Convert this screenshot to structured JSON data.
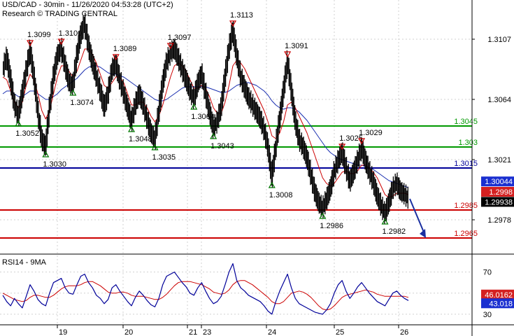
{
  "header": {
    "line1": "USD/CAD - 30min - 11/26/2020 04:53:28 (UTC+2)",
    "line2": "Research © TRADING CENTRAL"
  },
  "chart_data": {
    "type": "line",
    "instrument": "USD/CAD",
    "timeframe": "30min",
    "x_tick_labels": [
      "19",
      "20",
      "21",
      "23",
      "24",
      "25",
      "26"
    ],
    "price_panel": {
      "ylim": [
        1.2955,
        1.3135
      ],
      "y_tick_labels": [
        "1.3107",
        "1.3064",
        "1.3021",
        "1.2978"
      ],
      "y_tick_values": [
        1.3107,
        1.3064,
        1.3021,
        1.2978
      ],
      "price_path": [
        1.3085,
        1.3094,
        1.3078,
        1.306,
        1.3052,
        1.3068,
        1.3084,
        1.3099,
        1.308,
        1.3055,
        1.3035,
        1.303,
        1.3058,
        1.308,
        1.3095,
        1.31,
        1.3088,
        1.3076,
        1.3074,
        1.3095,
        1.311,
        1.3118,
        1.3102,
        1.309,
        1.308,
        1.307,
        1.3058,
        1.3068,
        1.3085,
        1.3089,
        1.3078,
        1.3068,
        1.3058,
        1.3048,
        1.306,
        1.3068,
        1.306,
        1.305,
        1.304,
        1.3035,
        1.3055,
        1.3075,
        1.309,
        1.3097,
        1.31,
        1.3093,
        1.3085,
        1.3078,
        1.307,
        1.3064,
        1.3075,
        1.3082,
        1.3068,
        1.3055,
        1.3043,
        1.3048,
        1.3058,
        1.308,
        1.31,
        1.3113,
        1.3095,
        1.308,
        1.3072,
        1.3065,
        1.306,
        1.3055,
        1.305,
        1.3042,
        1.303,
        1.3008,
        1.303,
        1.305,
        1.307,
        1.3091,
        1.307,
        1.3048,
        1.3035,
        1.303,
        1.3022,
        1.301,
        1.2998,
        1.299,
        1.2986,
        1.2992,
        1.3,
        1.3012,
        1.302,
        1.3026,
        1.3015,
        1.3005,
        1.3012,
        1.302,
        1.3029,
        1.302,
        1.3012,
        1.3005,
        1.2995,
        1.2988,
        1.2982,
        1.299,
        1.3,
        1.3004,
        1.2998,
        1.2996,
        1.2993
      ],
      "ma_fast": [
        1.308,
        1.3078,
        1.307,
        1.3062,
        1.3058,
        1.3062,
        1.3074,
        1.3082,
        1.3078,
        1.3068,
        1.3056,
        1.305,
        1.3056,
        1.3068,
        1.308,
        1.3088,
        1.3088,
        1.3084,
        1.308,
        1.3084,
        1.3092,
        1.31,
        1.31,
        1.3096,
        1.309,
        1.3082,
        1.3074,
        1.3072,
        1.3076,
        1.308,
        1.308,
        1.3076,
        1.3068,
        1.306,
        1.306,
        1.3062,
        1.3062,
        1.3058,
        1.3052,
        1.3048,
        1.3052,
        1.306,
        1.307,
        1.308,
        1.3088,
        1.309,
        1.3088,
        1.3084,
        1.3078,
        1.3072,
        1.3072,
        1.3074,
        1.3072,
        1.3066,
        1.3058,
        1.3054,
        1.3054,
        1.3062,
        1.3074,
        1.3088,
        1.3092,
        1.309,
        1.3086,
        1.308,
        1.3074,
        1.3068,
        1.3062,
        1.3056,
        1.3048,
        1.3038,
        1.3036,
        1.304,
        1.3048,
        1.306,
        1.3062,
        1.3058,
        1.3052,
        1.3046,
        1.304,
        1.3032,
        1.3024,
        1.3016,
        1.3008,
        1.3004,
        1.3002,
        1.3004,
        1.3008,
        1.3012,
        1.3013,
        1.3011,
        1.3011,
        1.3013,
        1.3017,
        1.3017,
        1.3015,
        1.3012,
        1.3008,
        1.3002,
        1.2996,
        1.2994,
        1.2995,
        1.2997,
        1.2997,
        1.2997,
        1.2996
      ],
      "ma_slow": [
        1.3068,
        1.307,
        1.307,
        1.3068,
        1.3066,
        1.3066,
        1.3068,
        1.307,
        1.307,
        1.3068,
        1.3066,
        1.3064,
        1.3064,
        1.3066,
        1.3068,
        1.3071,
        1.3073,
        1.3075,
        1.3077,
        1.3079,
        1.3082,
        1.3085,
        1.3087,
        1.3088,
        1.3088,
        1.3087,
        1.3085,
        1.3083,
        1.3082,
        1.3082,
        1.3081,
        1.308,
        1.3078,
        1.3076,
        1.3074,
        1.3072,
        1.307,
        1.3068,
        1.3066,
        1.3064,
        1.3063,
        1.3063,
        1.3064,
        1.3066,
        1.3068,
        1.307,
        1.3072,
        1.3073,
        1.3073,
        1.3073,
        1.3073,
        1.3073,
        1.3073,
        1.3072,
        1.3071,
        1.307,
        1.3069,
        1.3069,
        1.307,
        1.3072,
        1.3074,
        1.3075,
        1.3076,
        1.3076,
        1.3075,
        1.3074,
        1.3072,
        1.307,
        1.3067,
        1.3063,
        1.306,
        1.3058,
        1.3057,
        1.3058,
        1.3058,
        1.3057,
        1.3055,
        1.3052,
        1.3049,
        1.3045,
        1.3041,
        1.3037,
        1.3033,
        1.3029,
        1.3026,
        1.3024,
        1.3022,
        1.3021,
        1.302,
        1.3019,
        1.3018,
        1.3017,
        1.3017,
        1.3016,
        1.3015,
        1.3014,
        1.3012,
        1.301,
        1.3008,
        1.3006,
        1.3005,
        1.3004,
        1.3003,
        1.3002,
        1.3001
      ],
      "levels": [
        {
          "label": "1.3045",
          "value": 1.3045,
          "color": "#009900"
        },
        {
          "label": "1.303",
          "value": 1.303,
          "color": "#009900"
        },
        {
          "label": "1.3015",
          "value": 1.3015,
          "color": "#000099"
        },
        {
          "label": "1.2985",
          "value": 1.2985,
          "color": "#cc0000"
        },
        {
          "label": "1.2965",
          "value": 1.2965,
          "color": "#cc0000"
        }
      ],
      "current_price_tags": [
        {
          "label": "1.30044",
          "value": 1.30044,
          "color": "#1a2fd0"
        },
        {
          "label": "1.2998",
          "value": 1.2998,
          "color": "#d42020"
        },
        {
          "label": "1.29938",
          "value": 1.29938,
          "color": "#000000"
        }
      ],
      "forecast_arrow": {
        "from_value": 1.2993,
        "to_value": 1.2965,
        "color": "#1a2fa0"
      },
      "annotations": [
        {
          "label": "1.3099",
          "kind": "high",
          "t": 7
        },
        {
          "label": "1.3100",
          "kind": "high",
          "t": 15
        },
        {
          "label": "1.3089",
          "kind": "high",
          "t": 29
        },
        {
          "label": "1.3097",
          "kind": "high",
          "t": 43
        },
        {
          "label": "1.3113",
          "kind": "high",
          "t": 59
        },
        {
          "label": "1.3091",
          "kind": "high",
          "t": 73
        },
        {
          "label": "1.3025",
          "kind": "high",
          "t": 87
        },
        {
          "label": "1.3029",
          "kind": "high",
          "t": 92
        },
        {
          "label": "1.3052",
          "kind": "low",
          "t": 4
        },
        {
          "label": "1.3030",
          "kind": "low",
          "t": 11
        },
        {
          "label": "1.3074",
          "kind": "low",
          "t": 18
        },
        {
          "label": "1.3048",
          "kind": "low",
          "t": 33
        },
        {
          "label": "1.3035",
          "kind": "low",
          "t": 39
        },
        {
          "label": "1.3064",
          "kind": "low",
          "t": 49
        },
        {
          "label": "1.3043",
          "kind": "low",
          "t": 54
        },
        {
          "label": "1.3008",
          "kind": "low",
          "t": 69
        },
        {
          "label": "1.2986",
          "kind": "low",
          "t": 82
        },
        {
          "label": "1.2982",
          "kind": "low",
          "t": 98
        }
      ]
    },
    "rsi_panel": {
      "title": "RSI14 - 9MA",
      "ylim": [
        20,
        85
      ],
      "y_tick_labels": [
        "70",
        "50",
        "30"
      ],
      "y_tick_values": [
        70,
        50,
        30
      ],
      "rsi": [
        48,
        42,
        38,
        45,
        40,
        36,
        47,
        58,
        52,
        44,
        40,
        38,
        50,
        60,
        62,
        64,
        55,
        50,
        49,
        58,
        66,
        68,
        60,
        55,
        48,
        45,
        40,
        44,
        55,
        58,
        52,
        47,
        42,
        38,
        46,
        52,
        48,
        43,
        39,
        37,
        45,
        58,
        66,
        68,
        70,
        65,
        60,
        56,
        50,
        48,
        55,
        60,
        52,
        45,
        40,
        42,
        47,
        58,
        70,
        78,
        62,
        55,
        52,
        48,
        46,
        44,
        42,
        38,
        33,
        30,
        42,
        52,
        60,
        68,
        55,
        45,
        40,
        38,
        36,
        34,
        32,
        31,
        30,
        34,
        40,
        50,
        58,
        62,
        52,
        45,
        50,
        56,
        60,
        55,
        50,
        46,
        42,
        40,
        38,
        44,
        50,
        52,
        48,
        45,
        43
      ],
      "rsi_ma": [
        50,
        48,
        46,
        44,
        43,
        42,
        43,
        46,
        48,
        48,
        47,
        46,
        46,
        48,
        51,
        54,
        56,
        57,
        57,
        57,
        58,
        60,
        61,
        61,
        59,
        57,
        54,
        51,
        50,
        50,
        51,
        51,
        50,
        48,
        47,
        47,
        47,
        46,
        45,
        44,
        44,
        46,
        49,
        53,
        57,
        60,
        61,
        61,
        61,
        60,
        59,
        58,
        56,
        54,
        51,
        50,
        49,
        50,
        53,
        58,
        61,
        62,
        62,
        60,
        58,
        55,
        52,
        49,
        46,
        42,
        40,
        40,
        42,
        46,
        50,
        51,
        52,
        51,
        49,
        46,
        42,
        38,
        35,
        34,
        35,
        38,
        42,
        46,
        48,
        49,
        50,
        51,
        52,
        53,
        52,
        51,
        49,
        48,
        47,
        47,
        47,
        47,
        47,
        47,
        46
      ],
      "value_tags": [
        {
          "label": "46.0162",
          "value": 46.0162,
          "color": "#d42020"
        },
        {
          "label": "43.018",
          "value": 43.018,
          "color": "#1a2fd0"
        }
      ]
    },
    "colors": {
      "price": "#000000",
      "ma_fast": "#cc0000",
      "ma_slow": "#1a2fb0",
      "rsi": "#000099",
      "rsi_ma": "#cc0000",
      "high_marker": "#cc0000",
      "low_marker": "#007700",
      "grid": "#d0d0d0"
    }
  }
}
